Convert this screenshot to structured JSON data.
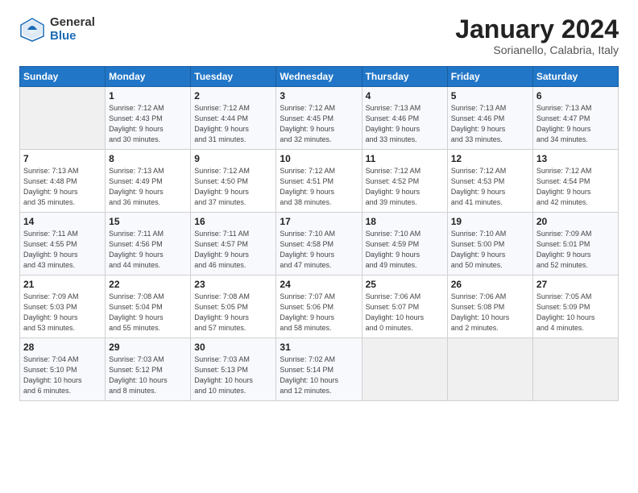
{
  "header": {
    "logo_general": "General",
    "logo_blue": "Blue",
    "month_title": "January 2024",
    "subtitle": "Sorianello, Calabria, Italy"
  },
  "days_of_week": [
    "Sunday",
    "Monday",
    "Tuesday",
    "Wednesday",
    "Thursday",
    "Friday",
    "Saturday"
  ],
  "weeks": [
    [
      {
        "day": "",
        "info": ""
      },
      {
        "day": "1",
        "info": "Sunrise: 7:12 AM\nSunset: 4:43 PM\nDaylight: 9 hours\nand 30 minutes."
      },
      {
        "day": "2",
        "info": "Sunrise: 7:12 AM\nSunset: 4:44 PM\nDaylight: 9 hours\nand 31 minutes."
      },
      {
        "day": "3",
        "info": "Sunrise: 7:12 AM\nSunset: 4:45 PM\nDaylight: 9 hours\nand 32 minutes."
      },
      {
        "day": "4",
        "info": "Sunrise: 7:13 AM\nSunset: 4:46 PM\nDaylight: 9 hours\nand 33 minutes."
      },
      {
        "day": "5",
        "info": "Sunrise: 7:13 AM\nSunset: 4:46 PM\nDaylight: 9 hours\nand 33 minutes."
      },
      {
        "day": "6",
        "info": "Sunrise: 7:13 AM\nSunset: 4:47 PM\nDaylight: 9 hours\nand 34 minutes."
      }
    ],
    [
      {
        "day": "7",
        "info": "Sunrise: 7:13 AM\nSunset: 4:48 PM\nDaylight: 9 hours\nand 35 minutes."
      },
      {
        "day": "8",
        "info": "Sunrise: 7:13 AM\nSunset: 4:49 PM\nDaylight: 9 hours\nand 36 minutes."
      },
      {
        "day": "9",
        "info": "Sunrise: 7:12 AM\nSunset: 4:50 PM\nDaylight: 9 hours\nand 37 minutes."
      },
      {
        "day": "10",
        "info": "Sunrise: 7:12 AM\nSunset: 4:51 PM\nDaylight: 9 hours\nand 38 minutes."
      },
      {
        "day": "11",
        "info": "Sunrise: 7:12 AM\nSunset: 4:52 PM\nDaylight: 9 hours\nand 39 minutes."
      },
      {
        "day": "12",
        "info": "Sunrise: 7:12 AM\nSunset: 4:53 PM\nDaylight: 9 hours\nand 41 minutes."
      },
      {
        "day": "13",
        "info": "Sunrise: 7:12 AM\nSunset: 4:54 PM\nDaylight: 9 hours\nand 42 minutes."
      }
    ],
    [
      {
        "day": "14",
        "info": "Sunrise: 7:11 AM\nSunset: 4:55 PM\nDaylight: 9 hours\nand 43 minutes."
      },
      {
        "day": "15",
        "info": "Sunrise: 7:11 AM\nSunset: 4:56 PM\nDaylight: 9 hours\nand 44 minutes."
      },
      {
        "day": "16",
        "info": "Sunrise: 7:11 AM\nSunset: 4:57 PM\nDaylight: 9 hours\nand 46 minutes."
      },
      {
        "day": "17",
        "info": "Sunrise: 7:10 AM\nSunset: 4:58 PM\nDaylight: 9 hours\nand 47 minutes."
      },
      {
        "day": "18",
        "info": "Sunrise: 7:10 AM\nSunset: 4:59 PM\nDaylight: 9 hours\nand 49 minutes."
      },
      {
        "day": "19",
        "info": "Sunrise: 7:10 AM\nSunset: 5:00 PM\nDaylight: 9 hours\nand 50 minutes."
      },
      {
        "day": "20",
        "info": "Sunrise: 7:09 AM\nSunset: 5:01 PM\nDaylight: 9 hours\nand 52 minutes."
      }
    ],
    [
      {
        "day": "21",
        "info": "Sunrise: 7:09 AM\nSunset: 5:03 PM\nDaylight: 9 hours\nand 53 minutes."
      },
      {
        "day": "22",
        "info": "Sunrise: 7:08 AM\nSunset: 5:04 PM\nDaylight: 9 hours\nand 55 minutes."
      },
      {
        "day": "23",
        "info": "Sunrise: 7:08 AM\nSunset: 5:05 PM\nDaylight: 9 hours\nand 57 minutes."
      },
      {
        "day": "24",
        "info": "Sunrise: 7:07 AM\nSunset: 5:06 PM\nDaylight: 9 hours\nand 58 minutes."
      },
      {
        "day": "25",
        "info": "Sunrise: 7:06 AM\nSunset: 5:07 PM\nDaylight: 10 hours\nand 0 minutes."
      },
      {
        "day": "26",
        "info": "Sunrise: 7:06 AM\nSunset: 5:08 PM\nDaylight: 10 hours\nand 2 minutes."
      },
      {
        "day": "27",
        "info": "Sunrise: 7:05 AM\nSunset: 5:09 PM\nDaylight: 10 hours\nand 4 minutes."
      }
    ],
    [
      {
        "day": "28",
        "info": "Sunrise: 7:04 AM\nSunset: 5:10 PM\nDaylight: 10 hours\nand 6 minutes."
      },
      {
        "day": "29",
        "info": "Sunrise: 7:03 AM\nSunset: 5:12 PM\nDaylight: 10 hours\nand 8 minutes."
      },
      {
        "day": "30",
        "info": "Sunrise: 7:03 AM\nSunset: 5:13 PM\nDaylight: 10 hours\nand 10 minutes."
      },
      {
        "day": "31",
        "info": "Sunrise: 7:02 AM\nSunset: 5:14 PM\nDaylight: 10 hours\nand 12 minutes."
      },
      {
        "day": "",
        "info": ""
      },
      {
        "day": "",
        "info": ""
      },
      {
        "day": "",
        "info": ""
      }
    ]
  ]
}
